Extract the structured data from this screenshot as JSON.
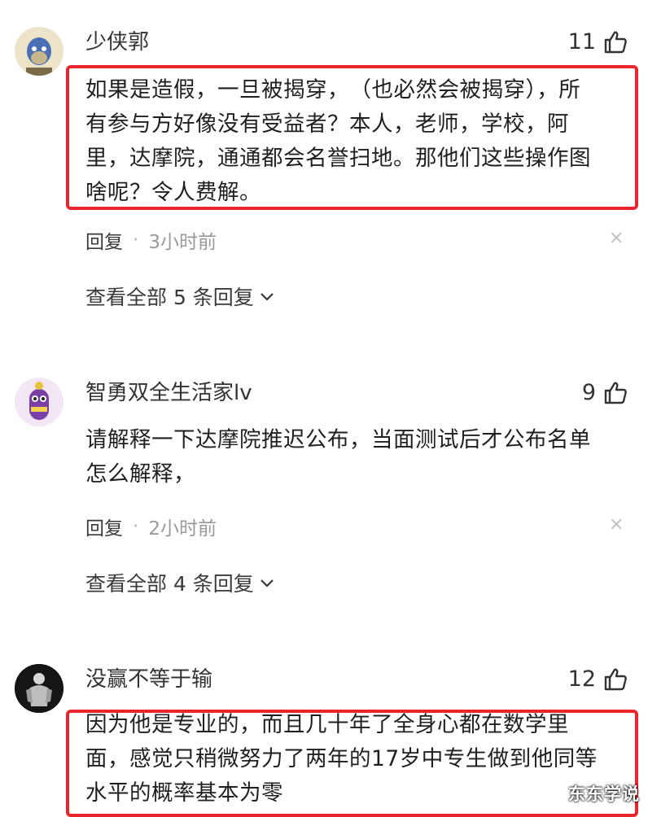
{
  "comments": [
    {
      "username": "少侠郭",
      "likes": "11",
      "text": [
        "如果是造假，一旦被揭穿，　（也必然会被揭穿），所",
        "有参与方好像没有受益者？本人，老师，学校，阿",
        "里，达摩院，通通都会名誉扫地。那他们这些操作图",
        "啥呢？令人费解。"
      ],
      "reply_label": "回复",
      "dot": "·",
      "time": "3小时前",
      "view_replies": "查看全部 5 条回复"
    },
    {
      "username": "智勇双全生活家lv",
      "likes": "9",
      "text": [
        "请解释一下达摩院推迟公布，当面测试后才公布名单",
        "怎么解释，"
      ],
      "reply_label": "回复",
      "dot": "·",
      "time": "2小时前",
      "view_replies": "查看全部 4 条回复"
    },
    {
      "username": "没赢不等于输",
      "likes": "12",
      "text": [
        "因为他是专业的，而且几十年了全身心都在数学里",
        "面，感觉只稍微努力了两年的17岁中专生做到他同等",
        "水平的概率基本为零"
      ]
    }
  ],
  "watermark": "东东学说",
  "colors": {
    "highlight": "#e8242c"
  }
}
